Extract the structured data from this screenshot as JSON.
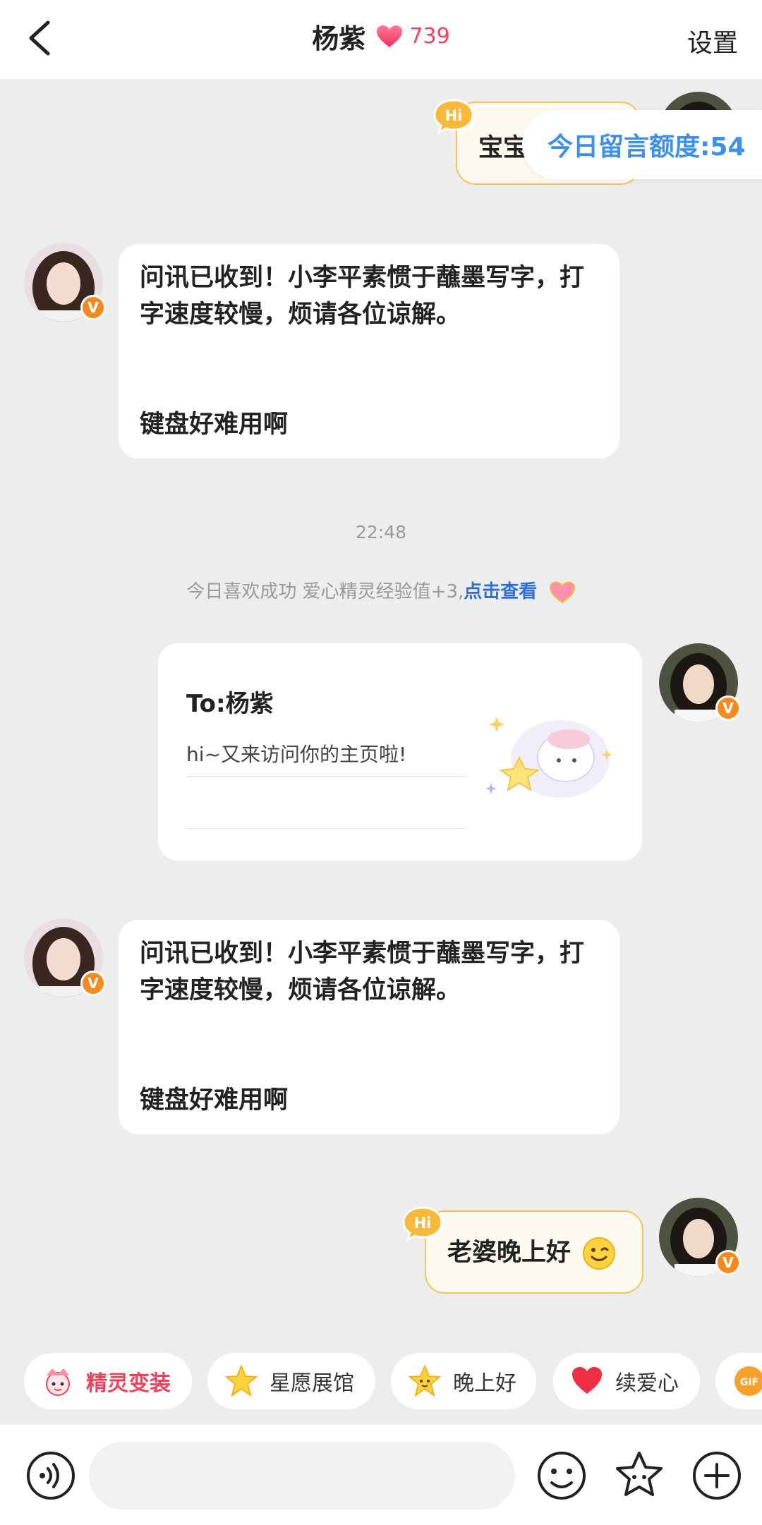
{
  "header": {
    "title": "杨紫",
    "heart_count": "739",
    "settings_label": "设置"
  },
  "quota": {
    "label": "今日留言额度:54"
  },
  "messages": [
    {
      "side": "right",
      "type": "greeting",
      "text": "宝宝"
    },
    {
      "side": "left",
      "type": "text",
      "line1": "问讯已收到！小李平素惯于蘸墨写字，打",
      "line2": "字速度较慢，烦请各位谅解。",
      "line3": "键盘好难用啊"
    },
    {
      "side": "right",
      "type": "card",
      "to": "To:杨紫",
      "body": "hi~又来访问你的主页啦!"
    },
    {
      "side": "left",
      "type": "text",
      "line1": "问讯已收到！小李平素惯于蘸墨写字，打",
      "line2": "字速度较慢，烦请各位谅解。",
      "line3": "键盘好难用啊"
    },
    {
      "side": "right",
      "type": "greeting",
      "text": "老婆晚上好"
    }
  ],
  "timestamp": "22:48",
  "system_notice": {
    "text": "今日喜欢成功 爱心精灵经验值+3,",
    "link": "点击查看"
  },
  "quick_chips": [
    {
      "label": "精灵变装",
      "icon": "sprite-icon",
      "color": "#f0405b"
    },
    {
      "label": "星愿展馆",
      "icon": "star-icon"
    },
    {
      "label": "晚上好",
      "icon": "star-face-icon"
    },
    {
      "label": "续爱心",
      "icon": "heart-icon"
    },
    {
      "label": "GIF",
      "icon": "gif-icon"
    }
  ],
  "input_bar": {
    "placeholder": ""
  },
  "colors": {
    "accent_heart": "#f2415f",
    "quota_blue": "#3d8fe8",
    "link_blue": "#2e6fd6",
    "greeting_border": "#f3c35e",
    "vip_badge": "#f58a1f"
  }
}
